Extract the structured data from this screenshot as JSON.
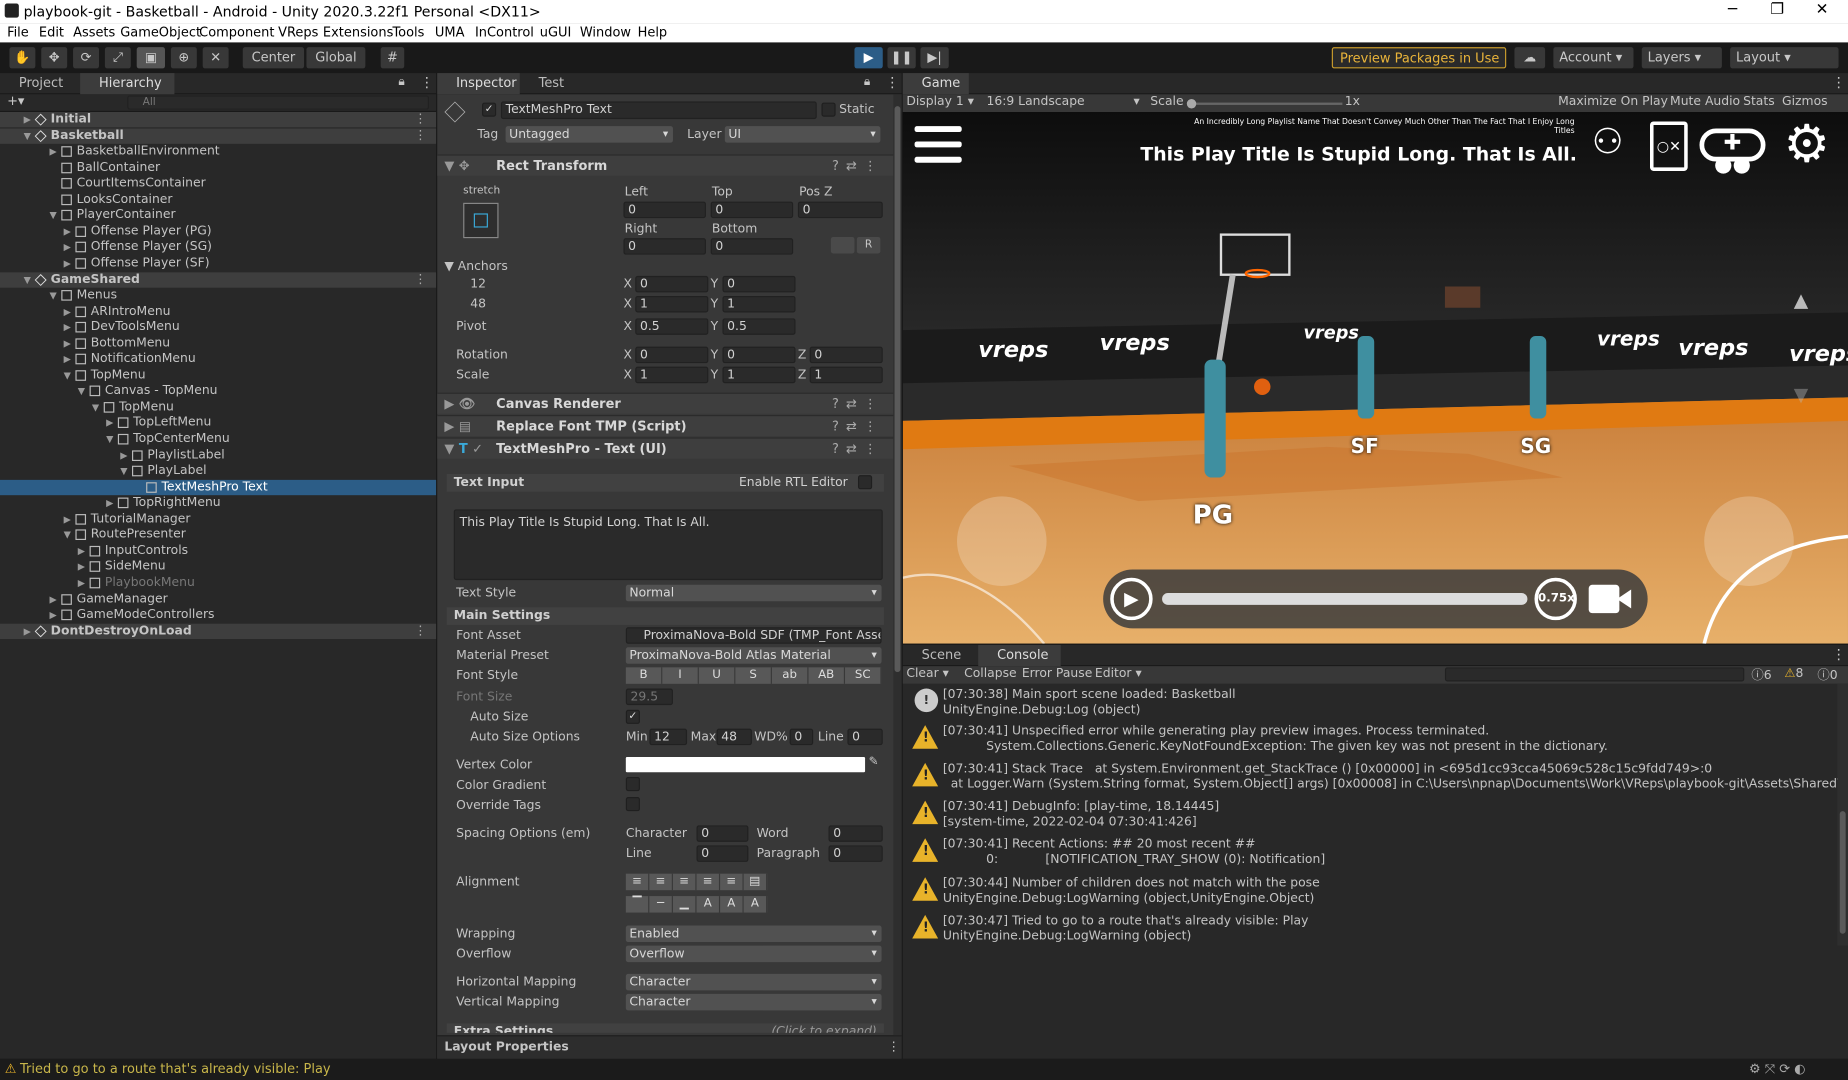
{
  "window": {
    "title": "playbook-git - Basketball - Android - Unity 2020.3.22f1 Personal <DX11>",
    "minimize": "─",
    "maximize": "❐",
    "close": "✕"
  },
  "menu": [
    "File",
    "Edit",
    "Assets",
    "GameObject",
    "Component",
    "VReps",
    "Extensions",
    "Tools",
    "UMA",
    "InControl",
    "uGUI",
    "Window",
    "Help"
  ],
  "toolbar": {
    "center": "Center",
    "global": "Global",
    "preview_packages": "Preview Packages in Use",
    "account": "Account",
    "layers": "Layers",
    "layout": "Layout"
  },
  "left_tabs": {
    "project": "Project",
    "hierarchy": "Hierarchy",
    "search_placeholder": "All"
  },
  "hierarchy": [
    {
      "label": "Initial",
      "depth": 0,
      "type": "scene",
      "arrow": "▶"
    },
    {
      "label": "Basketball",
      "depth": 0,
      "type": "scene",
      "arrow": "▼"
    },
    {
      "label": "BasketballEnvironment",
      "depth": 1,
      "arrow": "▶"
    },
    {
      "label": "BallContainer",
      "depth": 1,
      "arrow": ""
    },
    {
      "label": "CourtItemsContainer",
      "depth": 1,
      "arrow": ""
    },
    {
      "label": "LooksContainer",
      "depth": 1,
      "arrow": ""
    },
    {
      "label": "PlayerContainer",
      "depth": 1,
      "arrow": "▼"
    },
    {
      "label": "Offense Player (PG)",
      "depth": 2,
      "arrow": "▶"
    },
    {
      "label": "Offense Player (SG)",
      "depth": 2,
      "arrow": "▶"
    },
    {
      "label": "Offense Player (SF)",
      "depth": 2,
      "arrow": "▶"
    },
    {
      "label": "GameShared",
      "depth": 0,
      "type": "scene",
      "arrow": "▼"
    },
    {
      "label": "Menus",
      "depth": 1,
      "arrow": "▼"
    },
    {
      "label": "ARIntroMenu",
      "depth": 2,
      "arrow": "▶"
    },
    {
      "label": "DevToolsMenu",
      "depth": 2,
      "arrow": "▶"
    },
    {
      "label": "BottomMenu",
      "depth": 2,
      "arrow": "▶"
    },
    {
      "label": "NotificationMenu",
      "depth": 2,
      "arrow": "▶"
    },
    {
      "label": "TopMenu",
      "depth": 2,
      "arrow": "▼"
    },
    {
      "label": "Canvas - TopMenu",
      "depth": 3,
      "arrow": "▼"
    },
    {
      "label": "TopMenu",
      "depth": 4,
      "arrow": "▼"
    },
    {
      "label": "TopLeftMenu",
      "depth": 5,
      "arrow": "▶"
    },
    {
      "label": "TopCenterMenu",
      "depth": 5,
      "arrow": "▼"
    },
    {
      "label": "PlaylistLabel",
      "depth": 6,
      "arrow": "▶"
    },
    {
      "label": "PlayLabel",
      "depth": 6,
      "arrow": "▼"
    },
    {
      "label": "TextMeshPro Text",
      "depth": 7,
      "arrow": "",
      "type": "selected"
    },
    {
      "label": "TopRightMenu",
      "depth": 5,
      "arrow": "▶"
    },
    {
      "label": "TutorialManager",
      "depth": 2,
      "arrow": "▶"
    },
    {
      "label": "RoutePresenter",
      "depth": 2,
      "arrow": "▼"
    },
    {
      "label": "InputControls",
      "depth": 3,
      "arrow": "▶"
    },
    {
      "label": "SideMenu",
      "depth": 3,
      "arrow": "▶"
    },
    {
      "label": "PlaybookMenu",
      "depth": 3,
      "arrow": "▶",
      "type": "disabled"
    },
    {
      "label": "GameManager",
      "depth": 1,
      "arrow": "▶"
    },
    {
      "label": "GameModeControllers",
      "depth": 1,
      "arrow": "▶"
    },
    {
      "label": "DontDestroyOnLoad",
      "depth": 0,
      "type": "scene",
      "arrow": "▶"
    }
  ],
  "inspector": {
    "tab": "Inspector",
    "tab2": "Test Runner",
    "object_name": "TextMeshPro Text",
    "static": "Static",
    "tag_label": "Tag",
    "tag": "Untagged",
    "layer_label": "Layer",
    "layer": "UI",
    "rect_transform": "Rect Transform",
    "stretch": "stretch",
    "left_l": "Left",
    "left": "0",
    "top_l": "Top",
    "top": "0",
    "posz_l": "Pos Z",
    "posz": "0",
    "right_l": "Right",
    "right": "0",
    "bottom_l": "Bottom",
    "bottom": "0",
    "r_btn": "R",
    "anchors": "Anchors",
    "min": "12",
    "max": "48",
    "pivot": "Pivot",
    "rotation": "Rotation",
    "scale": "Scale",
    "amin_x": "0",
    "amin_y": "0",
    "amax_x": "1",
    "amax_y": "1",
    "piv_x": "0.5",
    "piv_y": "0.5",
    "rot_x": "0",
    "rot_y": "0",
    "rot_z": "0",
    "sc_x": "1",
    "sc_y": "1",
    "sc_z": "1",
    "X": "X",
    "Y": "Y",
    "Z": "Z",
    "canvas_renderer": "Canvas Renderer",
    "replace_font": "Replace Font TMP (Script)",
    "tmp": "TextMeshPro - Text (UI)",
    "text_input": "Text Input",
    "rtl": "Enable RTL Editor",
    "text_value": "This Play Title Is Stupid Long. That Is All.",
    "text_style_l": "Text Style",
    "text_style": "Normal",
    "main_settings": "Main Settings",
    "font_asset_l": "Font Asset",
    "font_asset": "ProximaNova-Bold SDF (TMP_Font Asse",
    "material_l": "Material Preset",
    "material": "ProximaNova-Bold Atlas Material",
    "font_style_l": "Font Style",
    "font_style_btns": [
      "B",
      "I",
      "U",
      "S",
      "ab",
      "AB",
      "SC"
    ],
    "font_size_l": "Font Size",
    "font_size": "29.5",
    "auto_size_l": "Auto Size",
    "auto_opts_l": "Auto Size Options",
    "min_l": "Min",
    "max_l": "Max",
    "wd_l": "WD%",
    "wd": "0",
    "line_l": "Line",
    "line": "0",
    "vertex_color_l": "Vertex Color",
    "color_gradient_l": "Color Gradient",
    "override_tags_l": "Override Tags",
    "spacing_l": "Spacing Options (em)",
    "char_l": "Character",
    "char": "0",
    "word_l": "Word",
    "word": "0",
    "line2_l": "Line",
    "line2": "0",
    "para_l": "Paragraph",
    "para": "0",
    "alignment_l": "Alignment",
    "wrapping_l": "Wrapping",
    "wrapping": "Enabled",
    "overflow_l": "Overflow",
    "overflow": "Overflow",
    "hmap_l": "Horizontal Mapping",
    "hmap": "Character",
    "vmap_l": "Vertical Mapping",
    "vmap": "Character",
    "extra": "Extra Settings",
    "click_expand": "(Click to expand)",
    "layout_props": "Layout Properties"
  },
  "game": {
    "tab": "Game",
    "display": "Display 1",
    "aspect": "16:9 Landscape",
    "scale_l": "Scale",
    "scale": "1x",
    "maximize": "Maximize On Play",
    "mute": "Mute Audio",
    "stats": "Stats",
    "gizmos": "Gizmos",
    "playlist": "An Incredibly Long Playlist Name That Doesn't Convey Much Other Than The Fact That I Enjoy Long Titles",
    "play_title": "This Play Title Is Stupid Long. That Is All.",
    "speed": "0.75x",
    "pg": "PG",
    "sf": "SF",
    "sg": "SG",
    "brand": "vreps"
  },
  "console": {
    "scene_tab": "Scene",
    "console_tab": "Console",
    "clear": "Clear",
    "collapse": "Collapse",
    "error_pause": "Error Pause",
    "editor": "Editor",
    "count_log": "6",
    "count_warn": "8",
    "count_err": "0",
    "rows": [
      {
        "type": "log",
        "l1": "[07:30:38] Main sport scene loaded: Basketball",
        "l2": "UnityEngine.Debug:Log (object)"
      },
      {
        "type": "warn",
        "l1": "[07:30:41] Unspecified error while generating play preview images. Process terminated.",
        "l2": "           System.Collections.Generic.KeyNotFoundException: The given key was not present in the dictionary."
      },
      {
        "type": "warn",
        "l1": "[07:30:41] Stack Trace   at System.Environment.get_StackTrace () [0x00000] in <695d1cc93cca45069c528c15c9fdd749>:0",
        "l2": "  at Logger.Warn (System.String format, System.Object[] args) [0x00008] in C:\\Users\\npnap\\Documents\\Work\\VReps\\playbook-git\\Assets\\Shared\\Scripts\\Utilitie"
      },
      {
        "type": "warn",
        "l1": "[07:30:41] DebugInfo: [play-time, 18.14445]",
        "l2": "[system-time, 2022-02-04 07:30:41:426]"
      },
      {
        "type": "warn",
        "l1": "[07:30:41] Recent Actions: ## 20 most recent ##",
        "l2": "           0:            [NOTIFICATION_TRAY_SHOW (0): Notification]"
      },
      {
        "type": "warn",
        "l1": "[07:30:44] Number of children does not match with the pose",
        "l2": "UnityEngine.Debug:LogWarning (object,UnityEngine.Object)"
      },
      {
        "type": "warn",
        "l1": "[07:30:47] Tried to go to a route that's already visible: Play",
        "l2": "UnityEngine.Debug:LogWarning (object)"
      }
    ]
  },
  "status_bar": "Tried to go to a route that's already visible: Play"
}
